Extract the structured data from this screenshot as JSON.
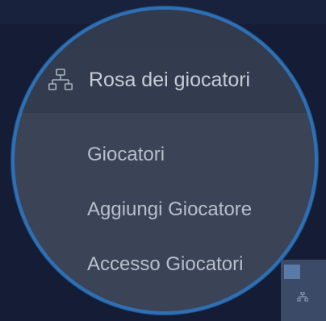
{
  "menu": {
    "header": {
      "label": "Rosa dei giocatori",
      "icon": "sitemap-icon"
    },
    "items": [
      {
        "label": "Giocatori"
      },
      {
        "label": "Aggiungi Giocatore"
      },
      {
        "label": "Accesso Giocatori"
      }
    ]
  },
  "colors": {
    "background": "#141d35",
    "lens_border": "#2f6fb4",
    "menu_background": "#3b4457",
    "text": "#b8bfcc"
  }
}
